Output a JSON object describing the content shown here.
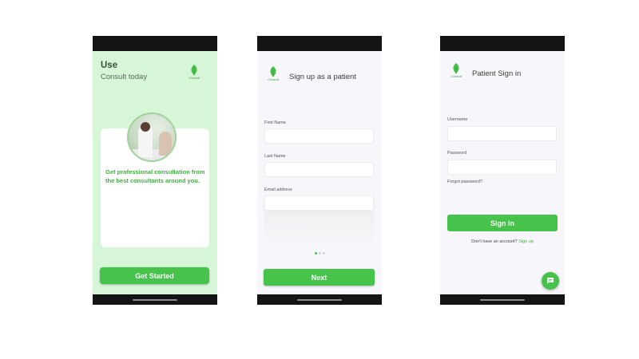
{
  "brand": {
    "logo_text": "Consult",
    "accent_color": "#47c24b",
    "onboarding_bg": "#d7f5d7"
  },
  "onboarding": {
    "heading": "Use",
    "subheading": "Consult today",
    "image_icon": "doctor-consultation-photo",
    "tagline": "Get professional consultation from the best consultants around you.",
    "cta_label": "Get Started"
  },
  "signup": {
    "title": "Sign up as a patient",
    "fields": [
      {
        "label": "First Name",
        "value": "",
        "placeholder": ""
      },
      {
        "label": "Last Name",
        "value": "",
        "placeholder": ""
      },
      {
        "label": "Email address",
        "value": "",
        "placeholder": ""
      }
    ],
    "pagination": {
      "total": 3,
      "current": 1
    },
    "next_label": "Next"
  },
  "signin": {
    "title": "Patient Sign in",
    "username_label": "Username",
    "username_value": "",
    "password_label": "Password",
    "password_value": "",
    "forgot_label": "Forgot password?",
    "signin_label": "Sign in",
    "no_account_text": "Don't have an account?",
    "signup_link": "Sign up",
    "fab_icon": "chat-icon"
  }
}
